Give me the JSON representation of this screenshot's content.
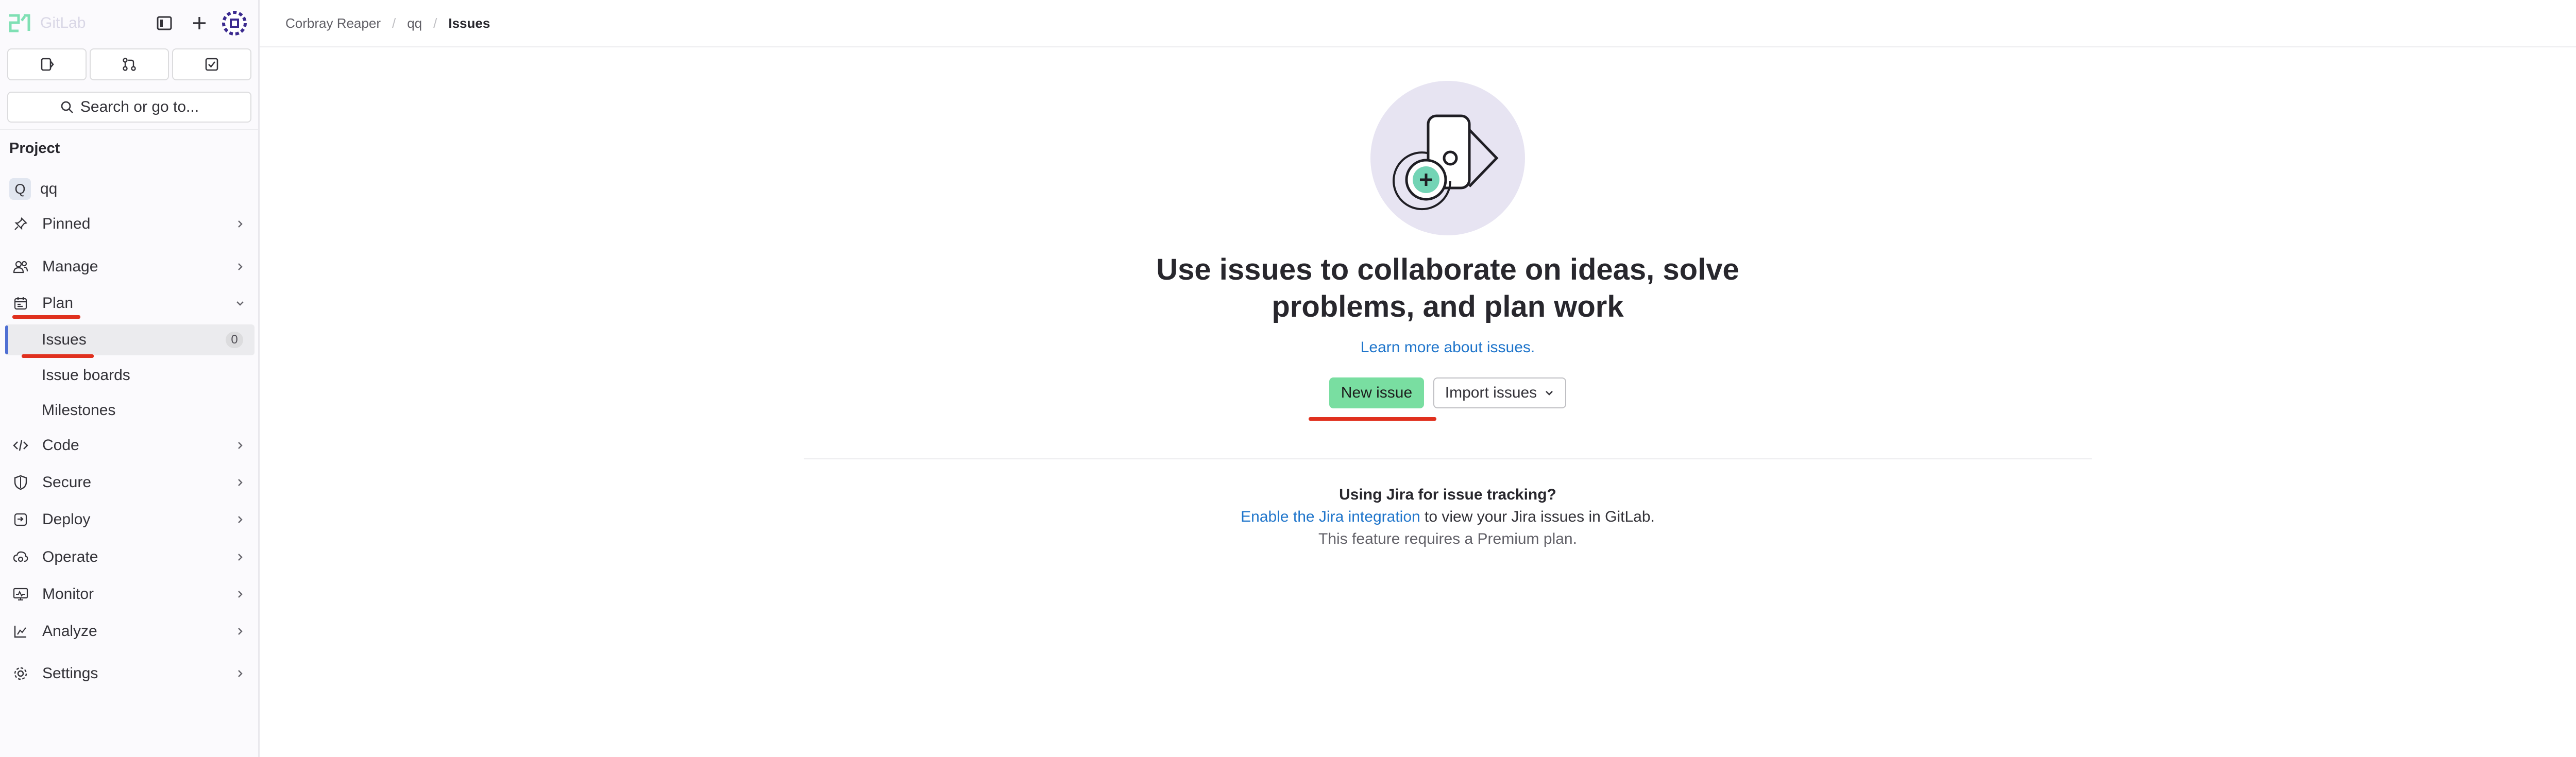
{
  "app": {
    "logo_text": "GitLab"
  },
  "sidebar": {
    "search_label": "Search or go to...",
    "section_title": "Project",
    "project": {
      "initial": "Q",
      "name": "qq"
    },
    "nav": [
      {
        "label": "Pinned"
      },
      {
        "label": "Manage"
      },
      {
        "label": "Plan"
      },
      {
        "label": "Code"
      },
      {
        "label": "Secure"
      },
      {
        "label": "Deploy"
      },
      {
        "label": "Operate"
      },
      {
        "label": "Monitor"
      },
      {
        "label": "Analyze"
      },
      {
        "label": "Settings"
      }
    ],
    "plan_items": [
      {
        "label": "Issues",
        "count": "0"
      },
      {
        "label": "Issue boards"
      },
      {
        "label": "Milestones"
      }
    ]
  },
  "breadcrumb": [
    "Corbray Reaper",
    "qq",
    "Issues"
  ],
  "empty_state": {
    "title_line1": "Use issues to collaborate on ideas, solve",
    "title_line2": "problems, and plan work",
    "learn_more": "Learn more about issues.",
    "new_issue": "New issue",
    "import_issues": "Import issues"
  },
  "jira": {
    "title": "Using Jira for issue tracking?",
    "link": "Enable the Jira integration",
    "rest": " to view your Jira issues in GitLab.",
    "note": "This feature requires a Premium plan."
  },
  "colors": {
    "accent": "#1f75cb",
    "confirm_button": "#79dea1",
    "annotation": "#e0301e",
    "active_indicator": "#4f6fd3"
  }
}
